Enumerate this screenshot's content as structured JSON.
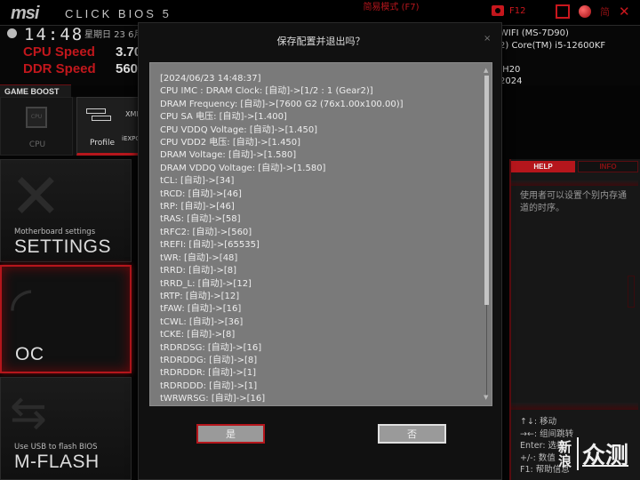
{
  "header": {
    "logo": "msi",
    "product": "CLICK BIOS 5",
    "ez_mode": "简易模式 (F7)",
    "screenshot_key": "F12",
    "language": "简",
    "close": "✕"
  },
  "status": {
    "time": "14:48",
    "date": "星期日 23 6月",
    "cpu_speed_label": "CPU Speed",
    "cpu_speed_value": "3.70",
    "ddr_speed_label": "DDR Speed",
    "ddr_speed_value": "560",
    "sysinfo": [
      "WIFI (MS-7D90)",
      "2) Core(TM) i5-12600KF",
      "",
      ".H20",
      "2024"
    ]
  },
  "game_boost": {
    "label": "GAME BOOST",
    "cpu_label": "CPU",
    "cpu_chip": "CPU",
    "profile_label": "Profile",
    "xmp": "XMP",
    "expo": "iEXPO"
  },
  "nav": {
    "settings_sub": "Motherboard settings",
    "settings_main": "SETTINGS",
    "oc_main": "OC",
    "mflash_sub": "Use USB to flash BIOS",
    "mflash_main": "M-FLASH"
  },
  "help": {
    "tab_help": "HELP",
    "tab_info": "INFO",
    "text": "使用者可以设置个别内存通道的时序。",
    "keys": [
      "↑↓: 移动",
      "→←: 组间跳转",
      "Enter: 选择",
      "+/-: 数值",
      "F1: 帮助信息"
    ]
  },
  "watermark": {
    "a": "新浪",
    "b": "众测"
  },
  "dialog": {
    "title": "保存配置并退出吗？",
    "close": "×",
    "log": [
      "[2024/06/23 14:48:37]",
      "CPU IMC : DRAM Clock: [自动]->[1/2 : 1 (Gear2)]",
      "DRAM Frequency: [自动]->[7600 G2 (76x1.00x100.00)]",
      "CPU SA 电压: [自动]->[1.400]",
      "CPU VDDQ Voltage: [自动]->[1.450]",
      "CPU VDD2 电压: [自动]->[1.450]",
      "DRAM Voltage: [自动]->[1.580]",
      "DRAM VDDQ Voltage: [自动]->[1.580]",
      "tCL: [自动]->[34]",
      "tRCD: [自动]->[46]",
      "tRP: [自动]->[46]",
      "tRAS: [自动]->[58]",
      "tRFC2: [自动]->[560]",
      "tREFI: [自动]->[65535]",
      "tWR: [自动]->[48]",
      "tRRD: [自动]->[8]",
      "tRRD_L: [自动]->[12]",
      "tRTP: [自动]->[12]",
      "tFAW: [自动]->[16]",
      "tCWL: [自动]->[36]",
      "tCKE: [自动]->[8]",
      "tRDRDSG: [自动]->[16]",
      "tRDRDDG: [自动]->[8]",
      "tRDRDDR: [自动]->[1]",
      "tRDRDDD: [自动]->[1]",
      "tWRWRSG: [自动]->[16]"
    ],
    "scroll_up": "▲",
    "scroll_down": "▼",
    "yes": "是",
    "no": "否"
  },
  "colors": {
    "accent": "#b5161c",
    "log_bg": "#7a7a7a",
    "dialog_bg": "#111111"
  }
}
